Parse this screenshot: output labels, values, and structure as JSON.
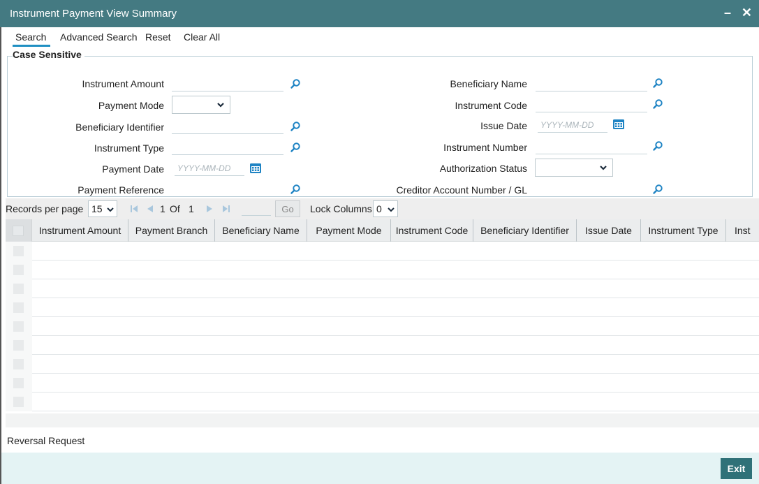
{
  "window": {
    "title": "Instrument Payment View Summary",
    "minimize_glyph": "–",
    "close_glyph": "✕"
  },
  "toolbar": {
    "search": "Search",
    "advanced_search": "Advanced Search",
    "reset": "Reset",
    "clear_all": "Clear All"
  },
  "form": {
    "legend": "Case Sensitive",
    "instrument_amount": {
      "label": "Instrument Amount",
      "value": ""
    },
    "payment_mode": {
      "label": "Payment Mode",
      "value": ""
    },
    "beneficiary_identifier": {
      "label": "Beneficiary Identifier",
      "value": ""
    },
    "instrument_type": {
      "label": "Instrument Type",
      "value": ""
    },
    "payment_date": {
      "label": "Payment Date",
      "placeholder": "YYYY-MM-DD"
    },
    "payment_reference": {
      "label": "Payment Reference",
      "value": ""
    },
    "beneficiary_name": {
      "label": "Beneficiary Name",
      "value": ""
    },
    "instrument_code": {
      "label": "Instrument Code",
      "value": ""
    },
    "issue_date": {
      "label": "Issue Date",
      "placeholder": "YYYY-MM-DD"
    },
    "instrument_number": {
      "label": "Instrument Number",
      "value": ""
    },
    "authorization_status": {
      "label": "Authorization Status",
      "value": ""
    },
    "creditor_account": {
      "label": "Creditor Account Number / GL",
      "value": ""
    }
  },
  "pagination": {
    "records_per_page_label": "Records per page",
    "records_per_page": "15",
    "current_page": "1",
    "of_label": "Of",
    "total_pages": "1",
    "go_label": "Go",
    "lock_columns_label": "Lock Columns",
    "lock_columns": "0"
  },
  "grid": {
    "columns": [
      "Instrument Amount",
      "Payment Branch",
      "Beneficiary Name",
      "Payment Mode",
      "Instrument Code",
      "Beneficiary Identifier",
      "Issue Date",
      "Instrument Type",
      "Inst"
    ]
  },
  "reversal_request": "Reversal Request",
  "footer": {
    "exit": "Exit"
  },
  "colors": {
    "title_bar": "#447a82",
    "accent": "#1f8fc2",
    "icon_blue": "#1f84c4",
    "exit_button": "#2f7178",
    "footer_bg": "#e4f3f4"
  }
}
